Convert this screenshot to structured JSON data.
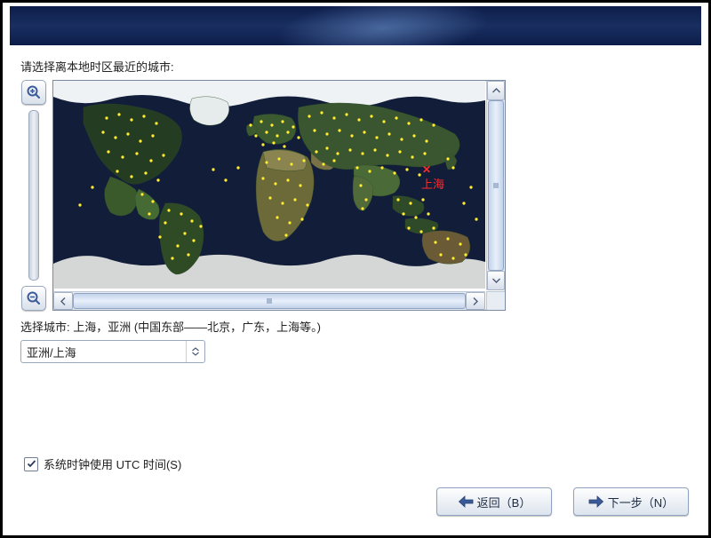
{
  "colors": {
    "header_gradient_a": "#0d1d4a",
    "header_gradient_b": "#192f60",
    "accent_red": "#ff2a2a",
    "city_dot": "#ffee33"
  },
  "prompt": "请选择离本地时区最近的城市:",
  "selected_marker_label": "上海",
  "city_label_line": "选择城市: 上海，亚洲 (中国东部——北京，广东，上海等。)",
  "timezone_combo_value": "亚洲/上海",
  "utc_checkbox": {
    "checked": true,
    "label": "系统时钟使用 UTC 时间(S)"
  },
  "buttons": {
    "back": "返回（B）",
    "next": "下一步（N）"
  },
  "icons": {
    "zoom_in": "zoom-in-icon",
    "zoom_out": "zoom-out-icon",
    "arrow_up": "chevron-up-icon",
    "arrow_down": "chevron-down-icon",
    "arrow_left": "chevron-left-icon",
    "arrow_right": "chevron-right-icon",
    "checkmark": "checkmark-icon"
  }
}
